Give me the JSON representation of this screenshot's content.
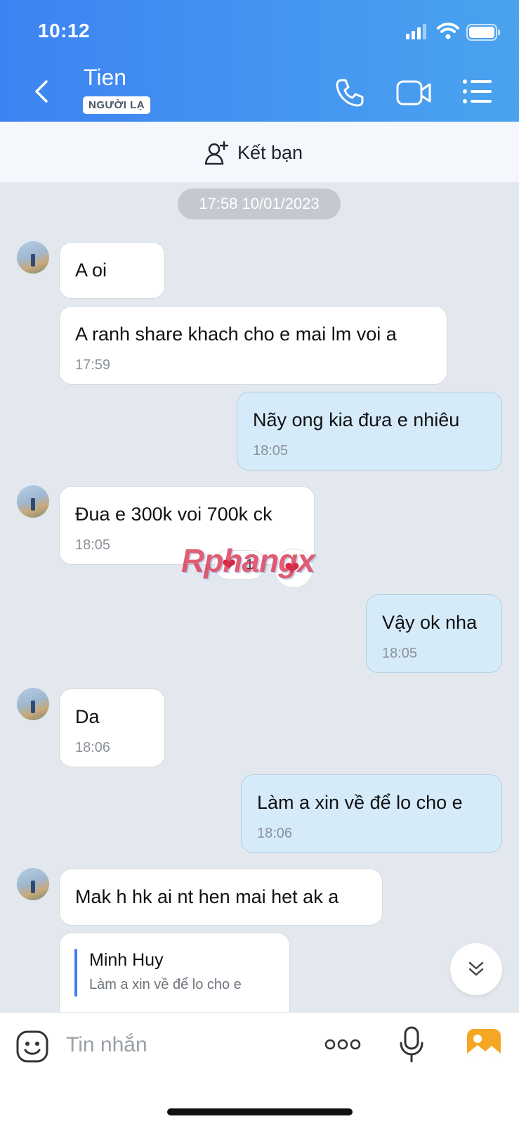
{
  "status_bar": {
    "time": "10:12"
  },
  "header": {
    "contact_name": "Tien",
    "badge": "NGƯỜI LẠ"
  },
  "add_friend": {
    "label": "Kết bạn"
  },
  "chat": {
    "date_separator": "17:58 10/01/2023",
    "messages": [
      {
        "side": "in",
        "text": "A oi",
        "time": ""
      },
      {
        "side": "in",
        "text": "A ranh share khach cho e mai lm voi a",
        "time": "17:59"
      },
      {
        "side": "out",
        "text": "Nãy ong kia đưa e nhiêu",
        "time": "18:05"
      },
      {
        "side": "in",
        "text": "Đua e 300k voi 700k ck",
        "time": "18:05",
        "reaction_count": "1"
      },
      {
        "side": "out",
        "text": "Vậy ok nha",
        "time": "18:05"
      },
      {
        "side": "in",
        "text": "Da",
        "time": "18:06"
      },
      {
        "side": "out",
        "text": "Làm a xin về để lo cho e",
        "time": "18:06"
      },
      {
        "side": "in",
        "text": "Mak h hk ai nt hen mai het ak a",
        "time": ""
      },
      {
        "side": "in",
        "quote_author": "Minh Huy",
        "quote_text": "Làm a xin về để lo cho e"
      }
    ]
  },
  "watermark": "Rphangx",
  "input": {
    "placeholder": "Tin nhắn"
  },
  "colors": {
    "header_start": "#3d83f2",
    "header_end": "#4aa3ef",
    "outgoing_bubble": "#d5ebfa",
    "incoming_bubble": "#ffffff",
    "chat_background": "#e3e8ef",
    "quote_bar": "#3c7ff0"
  }
}
